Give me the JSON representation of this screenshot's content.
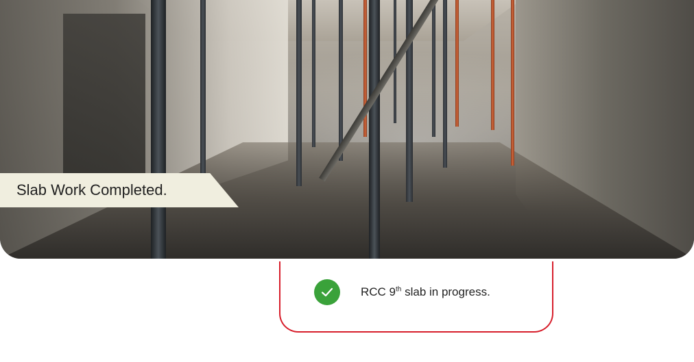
{
  "photo": {
    "caption": "Slab Work Completed."
  },
  "status_card": {
    "icon": "check-circle-icon",
    "accent_color": "#d71d2a",
    "icon_color": "#3aa23a",
    "text_prefix": "RCC 9",
    "text_superscript": "th",
    "text_suffix": " slab in progress."
  }
}
